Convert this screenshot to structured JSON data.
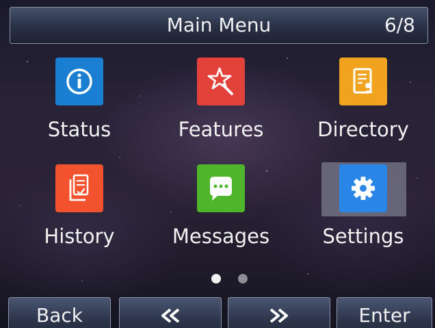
{
  "header": {
    "title": "Main Menu",
    "page_indicator": "6/8"
  },
  "menu": {
    "items": [
      {
        "label": "Status",
        "icon": "info-icon",
        "color": "#1a7fd1"
      },
      {
        "label": "Features",
        "icon": "features-star-icon",
        "color": "#e24239"
      },
      {
        "label": "Directory",
        "icon": "directory-book-icon",
        "color": "#f0a31e"
      },
      {
        "label": "History",
        "icon": "history-documents-icon",
        "color": "#f2522e"
      },
      {
        "label": "Messages",
        "icon": "message-bubble-icon",
        "color": "#4fb52a"
      },
      {
        "label": "Settings",
        "icon": "gear-icon",
        "color": "#2a86e6",
        "selected": true
      }
    ]
  },
  "pagination": {
    "pages": 2,
    "active_page": 1
  },
  "softkeys": {
    "back": "Back",
    "prev": "rewind-icon",
    "next": "fast-forward-icon",
    "enter": "Enter"
  }
}
